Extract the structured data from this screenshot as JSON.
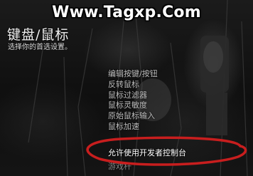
{
  "watermark": "Www.Tagxp.Com",
  "header": {
    "title": "键盘/鼠标",
    "subtitle": "选择你的首选设置。"
  },
  "menu": {
    "items": [
      "编辑按键/按钮",
      "反转鼠标",
      "鼠标过滤器",
      "鼠标灵敏度",
      "原始鼠标输入",
      "鼠标加速"
    ],
    "highlighted": "允许使用开发者控制台",
    "partial": "游戏杆"
  },
  "colors": {
    "annotation": "#c81e1e",
    "background": "#0b0b0b"
  }
}
